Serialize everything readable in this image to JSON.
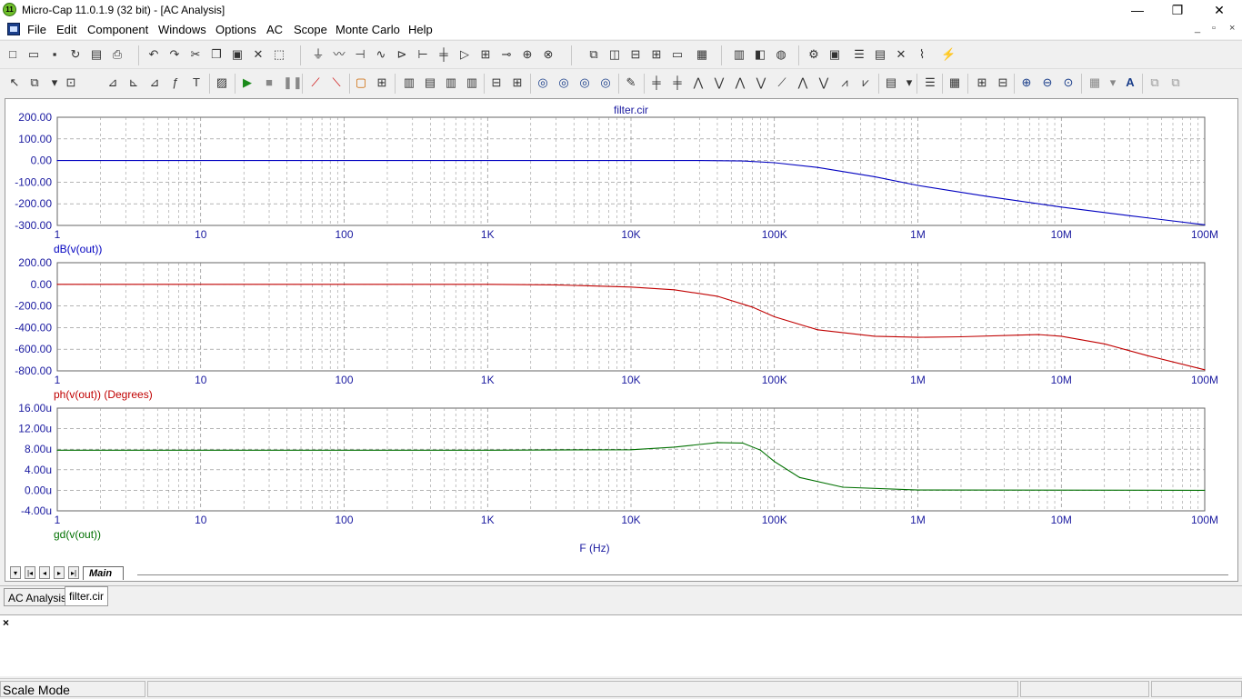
{
  "window": {
    "title": "Micro-Cap 11.0.1.9 (32 bit) - [AC Analysis]",
    "app_icon_text": "11",
    "minimize": "—",
    "restore": "❐",
    "close": "✕"
  },
  "menu": {
    "items": [
      "File",
      "Edit",
      "Component",
      "Windows",
      "Options",
      "AC",
      "Scope",
      "Monte Carlo",
      "Help"
    ],
    "mdi_minimize": "_",
    "mdi_restore": "▫",
    "mdi_close": "×"
  },
  "plot": {
    "title": "filter.cir",
    "x_axis_label": "F (Hz)"
  },
  "chart_data": [
    {
      "type": "line",
      "title": "filter.cir",
      "ylabel": "dB(v(out))",
      "xscale": "log",
      "xlim": [
        1,
        100000000
      ],
      "ylim": [
        -300,
        200
      ],
      "x_ticks": [
        "1",
        "10",
        "100",
        "1K",
        "10K",
        "100K",
        "1M",
        "10M",
        "100M"
      ],
      "y_ticks": [
        "200.00",
        "100.00",
        "0.00",
        "-100.00",
        "-200.00",
        "-300.00"
      ],
      "grid": true,
      "color": "#0000c0",
      "x": [
        1,
        1000,
        10000,
        30000,
        60000,
        100000,
        200000,
        500000,
        1000000,
        3000000,
        10000000,
        30000000,
        100000000
      ],
      "y": [
        0,
        0,
        0,
        0,
        -2,
        -10,
        -32,
        -75,
        -115,
        -165,
        -215,
        -255,
        -297
      ]
    },
    {
      "type": "line",
      "ylabel": "ph(v(out)) (Degrees)",
      "xscale": "log",
      "xlim": [
        1,
        100000000
      ],
      "ylim": [
        -800,
        200
      ],
      "x_ticks": [
        "1",
        "10",
        "100",
        "1K",
        "10K",
        "100K",
        "1M",
        "10M",
        "100M"
      ],
      "y_ticks": [
        "200.00",
        "0.00",
        "-200.00",
        "-400.00",
        "-600.00",
        "-800.00"
      ],
      "grid": true,
      "color": "#c00000",
      "x": [
        1,
        1000,
        3000,
        10000,
        20000,
        40000,
        70000,
        100000,
        200000,
        500000,
        1000000,
        2000000,
        5000000,
        7000000,
        10000000,
        20000000,
        40000000,
        100000000
      ],
      "y": [
        0,
        0,
        -5,
        -25,
        -50,
        -110,
        -210,
        -300,
        -420,
        -480,
        -490,
        -485,
        -470,
        -465,
        -480,
        -550,
        -660,
        -790
      ]
    },
    {
      "type": "line",
      "ylabel": "gd(v(out))",
      "xscale": "log",
      "xlim": [
        1,
        100000000
      ],
      "ylim": [
        -4,
        16
      ],
      "x_ticks": [
        "1",
        "10",
        "100",
        "1K",
        "10K",
        "100K",
        "1M",
        "10M",
        "100M"
      ],
      "y_ticks": [
        "16.00u",
        "12.00u",
        "8.00u",
        "4.00u",
        "0.00u",
        "-4.00u"
      ],
      "grid": true,
      "color": "#007000",
      "xlabel": "F (Hz)",
      "x": [
        1,
        1000,
        10000,
        20000,
        40000,
        60000,
        80000,
        100000,
        150000,
        300000,
        1000000,
        100000000
      ],
      "y": [
        7.8,
        7.8,
        7.9,
        8.4,
        9.3,
        9.2,
        7.8,
        5.6,
        2.5,
        0.6,
        0.05,
        0
      ]
    }
  ],
  "tabs": {
    "main": "Main"
  },
  "window_tabs": [
    "AC Analysis",
    "filter.cir"
  ],
  "output_pane": {
    "close": "×"
  },
  "status": {
    "mode": "Scale Mode"
  }
}
